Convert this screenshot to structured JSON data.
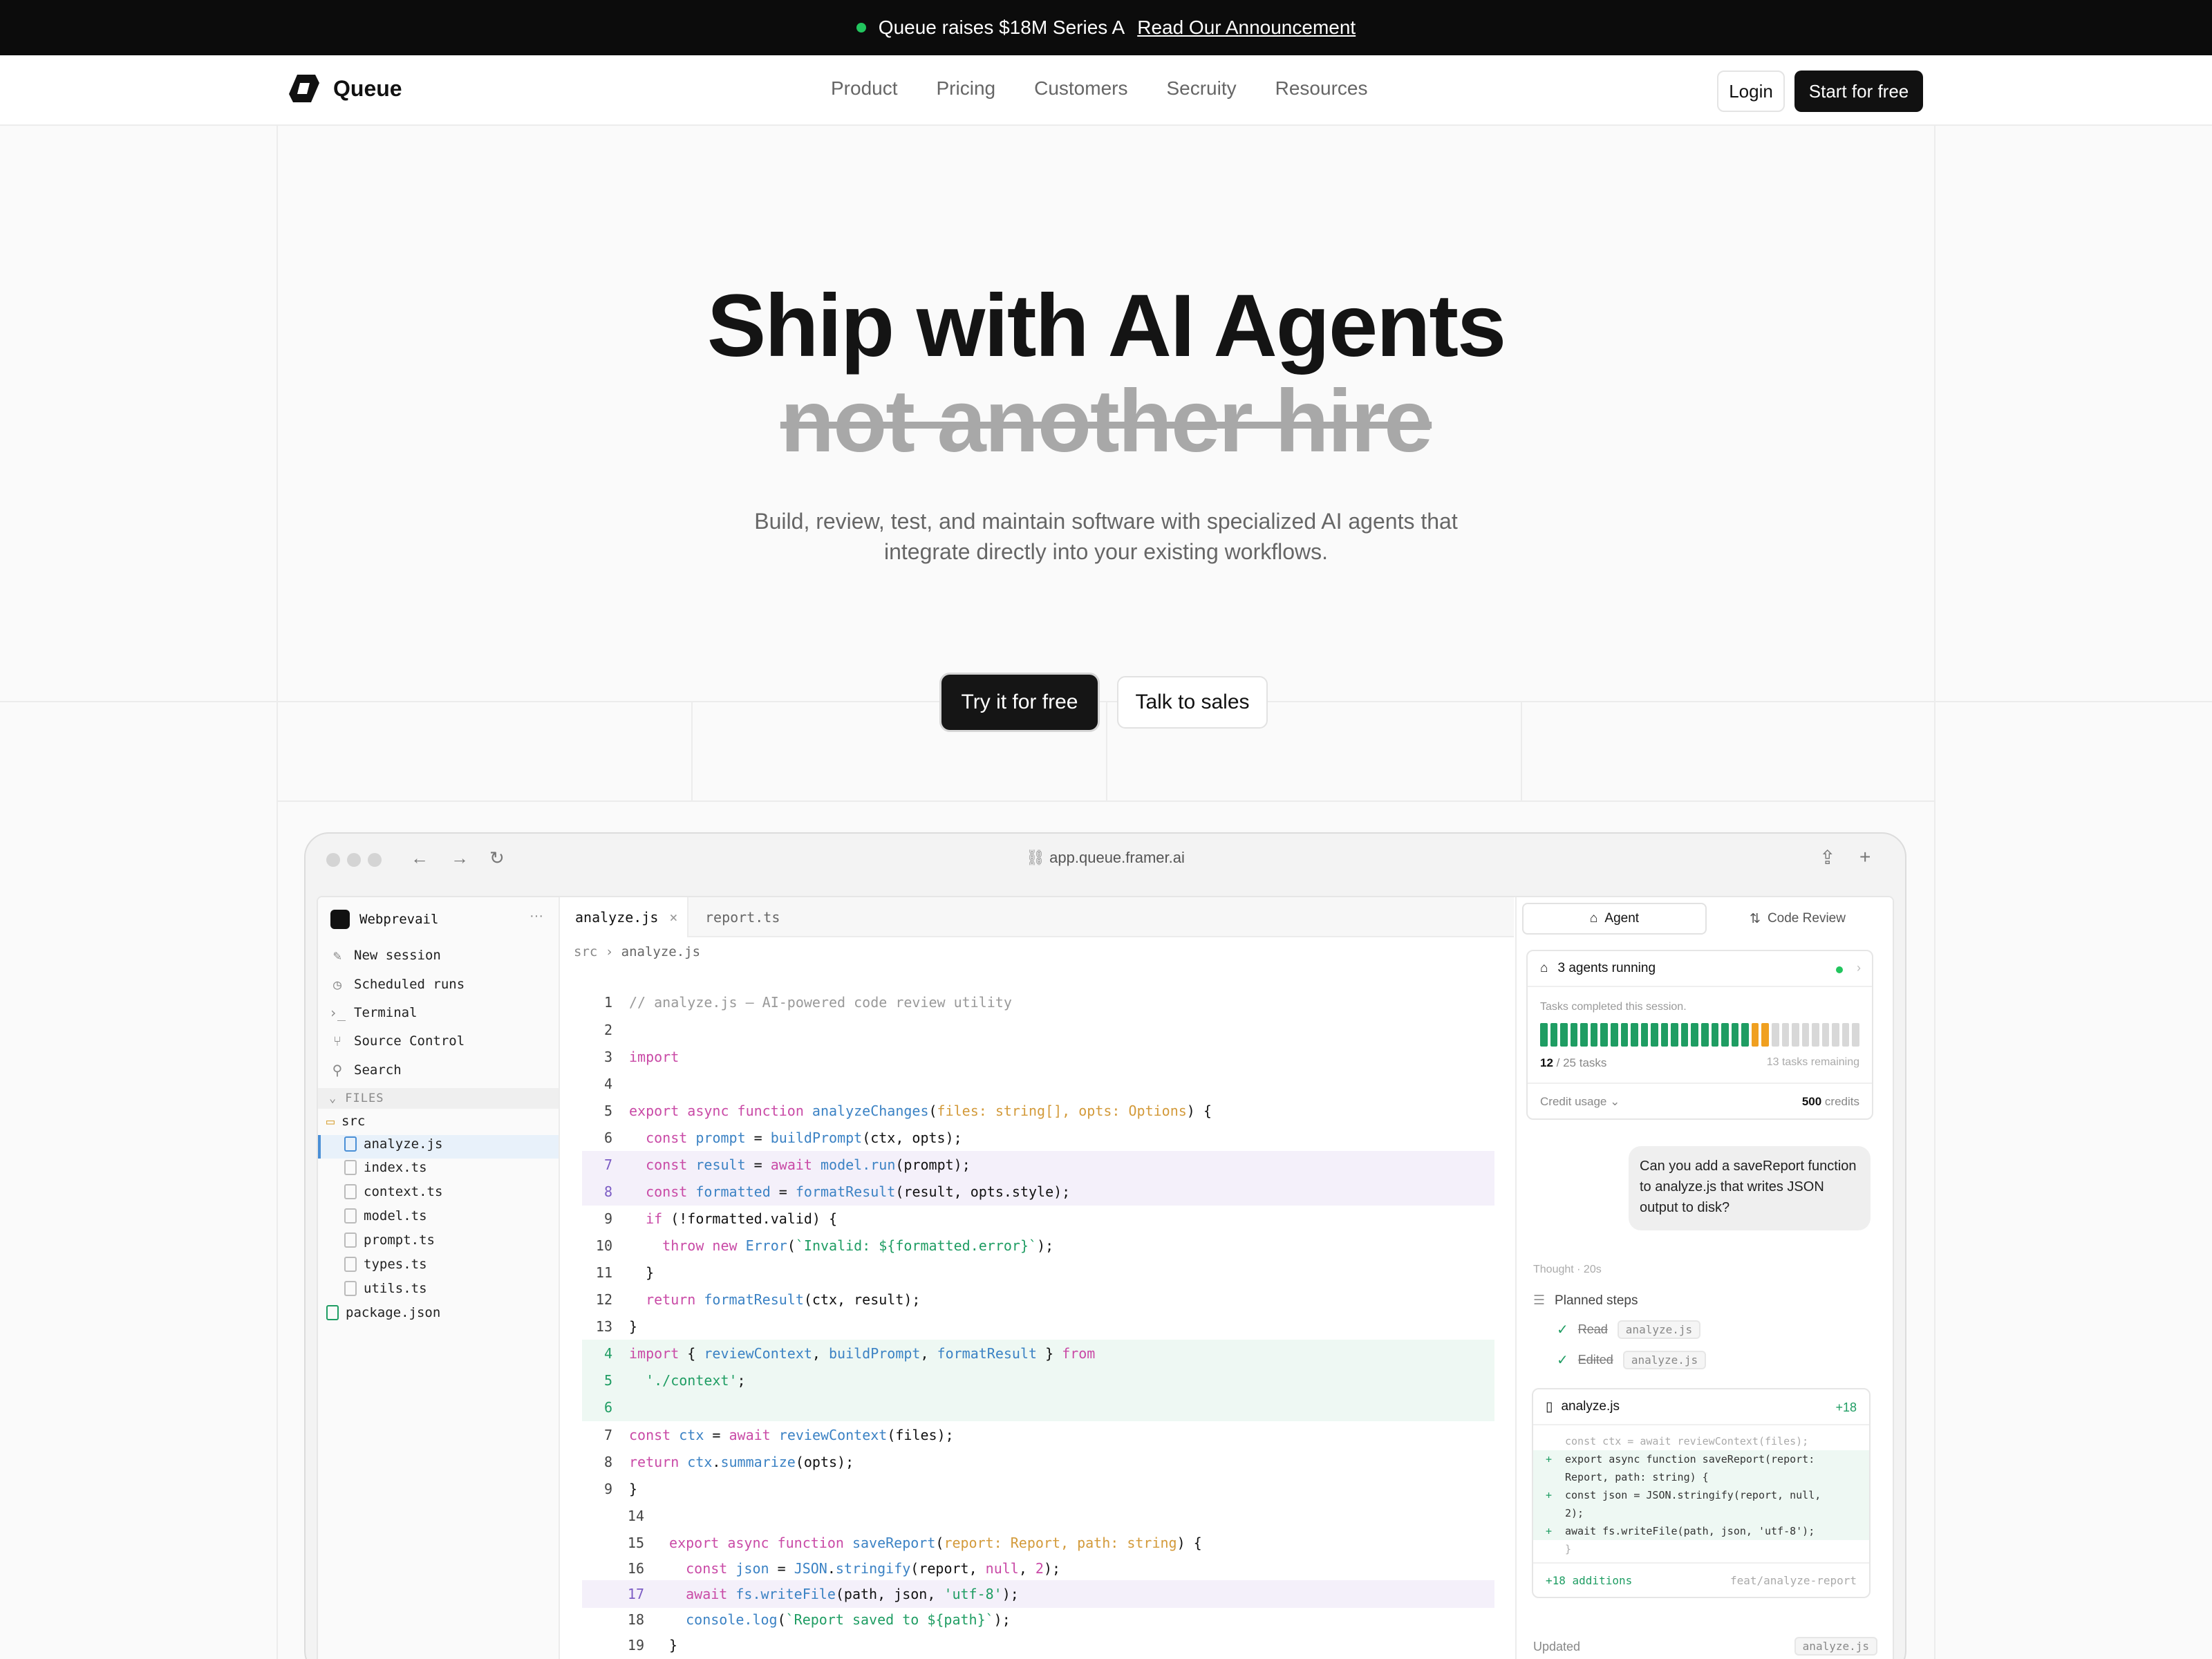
{
  "announcement": {
    "text": "Queue raises $18M Series A",
    "link": "Read Our Announcement"
  },
  "nav": {
    "brand": "Queue",
    "links": [
      "Product",
      "Pricing",
      "Customers",
      "Secruity",
      "Resources"
    ],
    "login": "Login",
    "start": "Start for free"
  },
  "hero": {
    "title": "Ship with AI Agents",
    "strike": "not another hire",
    "subtitle_line1": "Build, review, test, and maintain software with specialized AI agents that",
    "subtitle_line2": "integrate directly into your existing workflows.",
    "cta_primary": "Try it for free",
    "cta_secondary": "Talk to sales"
  },
  "app": {
    "url": "app.queue.framer.ai",
    "workspace": "Webprevail",
    "sidebar": {
      "items": [
        "New session",
        "Scheduled runs",
        "Terminal",
        "Source Control",
        "Search"
      ],
      "files_header": "FILES",
      "folder": "src",
      "files": [
        "analyze.js",
        "index.ts",
        "context.ts",
        "model.ts",
        "prompt.ts",
        "types.ts",
        "utils.ts"
      ],
      "root_file": "package.json"
    },
    "editor": {
      "tabs": [
        "analyze.js",
        "report.ts"
      ],
      "breadcrumb_dir": "src",
      "breadcrumb_file": "analyze.js"
    },
    "panel": {
      "tab_agent": "Agent",
      "tab_review": "Code Review",
      "agents_running": "3 agents running",
      "tasks_label": "Tasks completed this session.",
      "tasks_done": "12",
      "tasks_total": "/ 25 tasks",
      "tasks_remaining": "13 tasks remaining",
      "progress": {
        "completed": 21,
        "in_progress": 2,
        "total": 32
      },
      "credit_label": "Credit usage",
      "credits_value": "500",
      "credits_unit": "credits",
      "message": "Can you add a saveReport function to analyze.js that writes JSON output to disk?",
      "thought": "Thought · 20s",
      "planned": "Planned steps",
      "step1": "Read",
      "step2": "Edited",
      "step_chip": "analyze.js",
      "diff_file": "analyze.js",
      "diff_adds": "+18",
      "diff_lines": [
        "const ctx = await reviewContext(files);",
        "export async function saveReport(report:",
        "Report, path: string) {",
        "  const json = JSON.stringify(report, null,",
        "2);",
        "  await fs.writeFile(path, json, 'utf-8');",
        "}"
      ],
      "diff_foot_left": "+18 additions",
      "diff_foot_right": "feat/analyze-report",
      "updated": "Updated",
      "updated_chip": "analyze.js"
    }
  },
  "colors": {
    "accent_dark": "#111111",
    "status_green": "#22c55e",
    "progress_done": "#1f9d63",
    "progress_active": "#f0a020"
  }
}
